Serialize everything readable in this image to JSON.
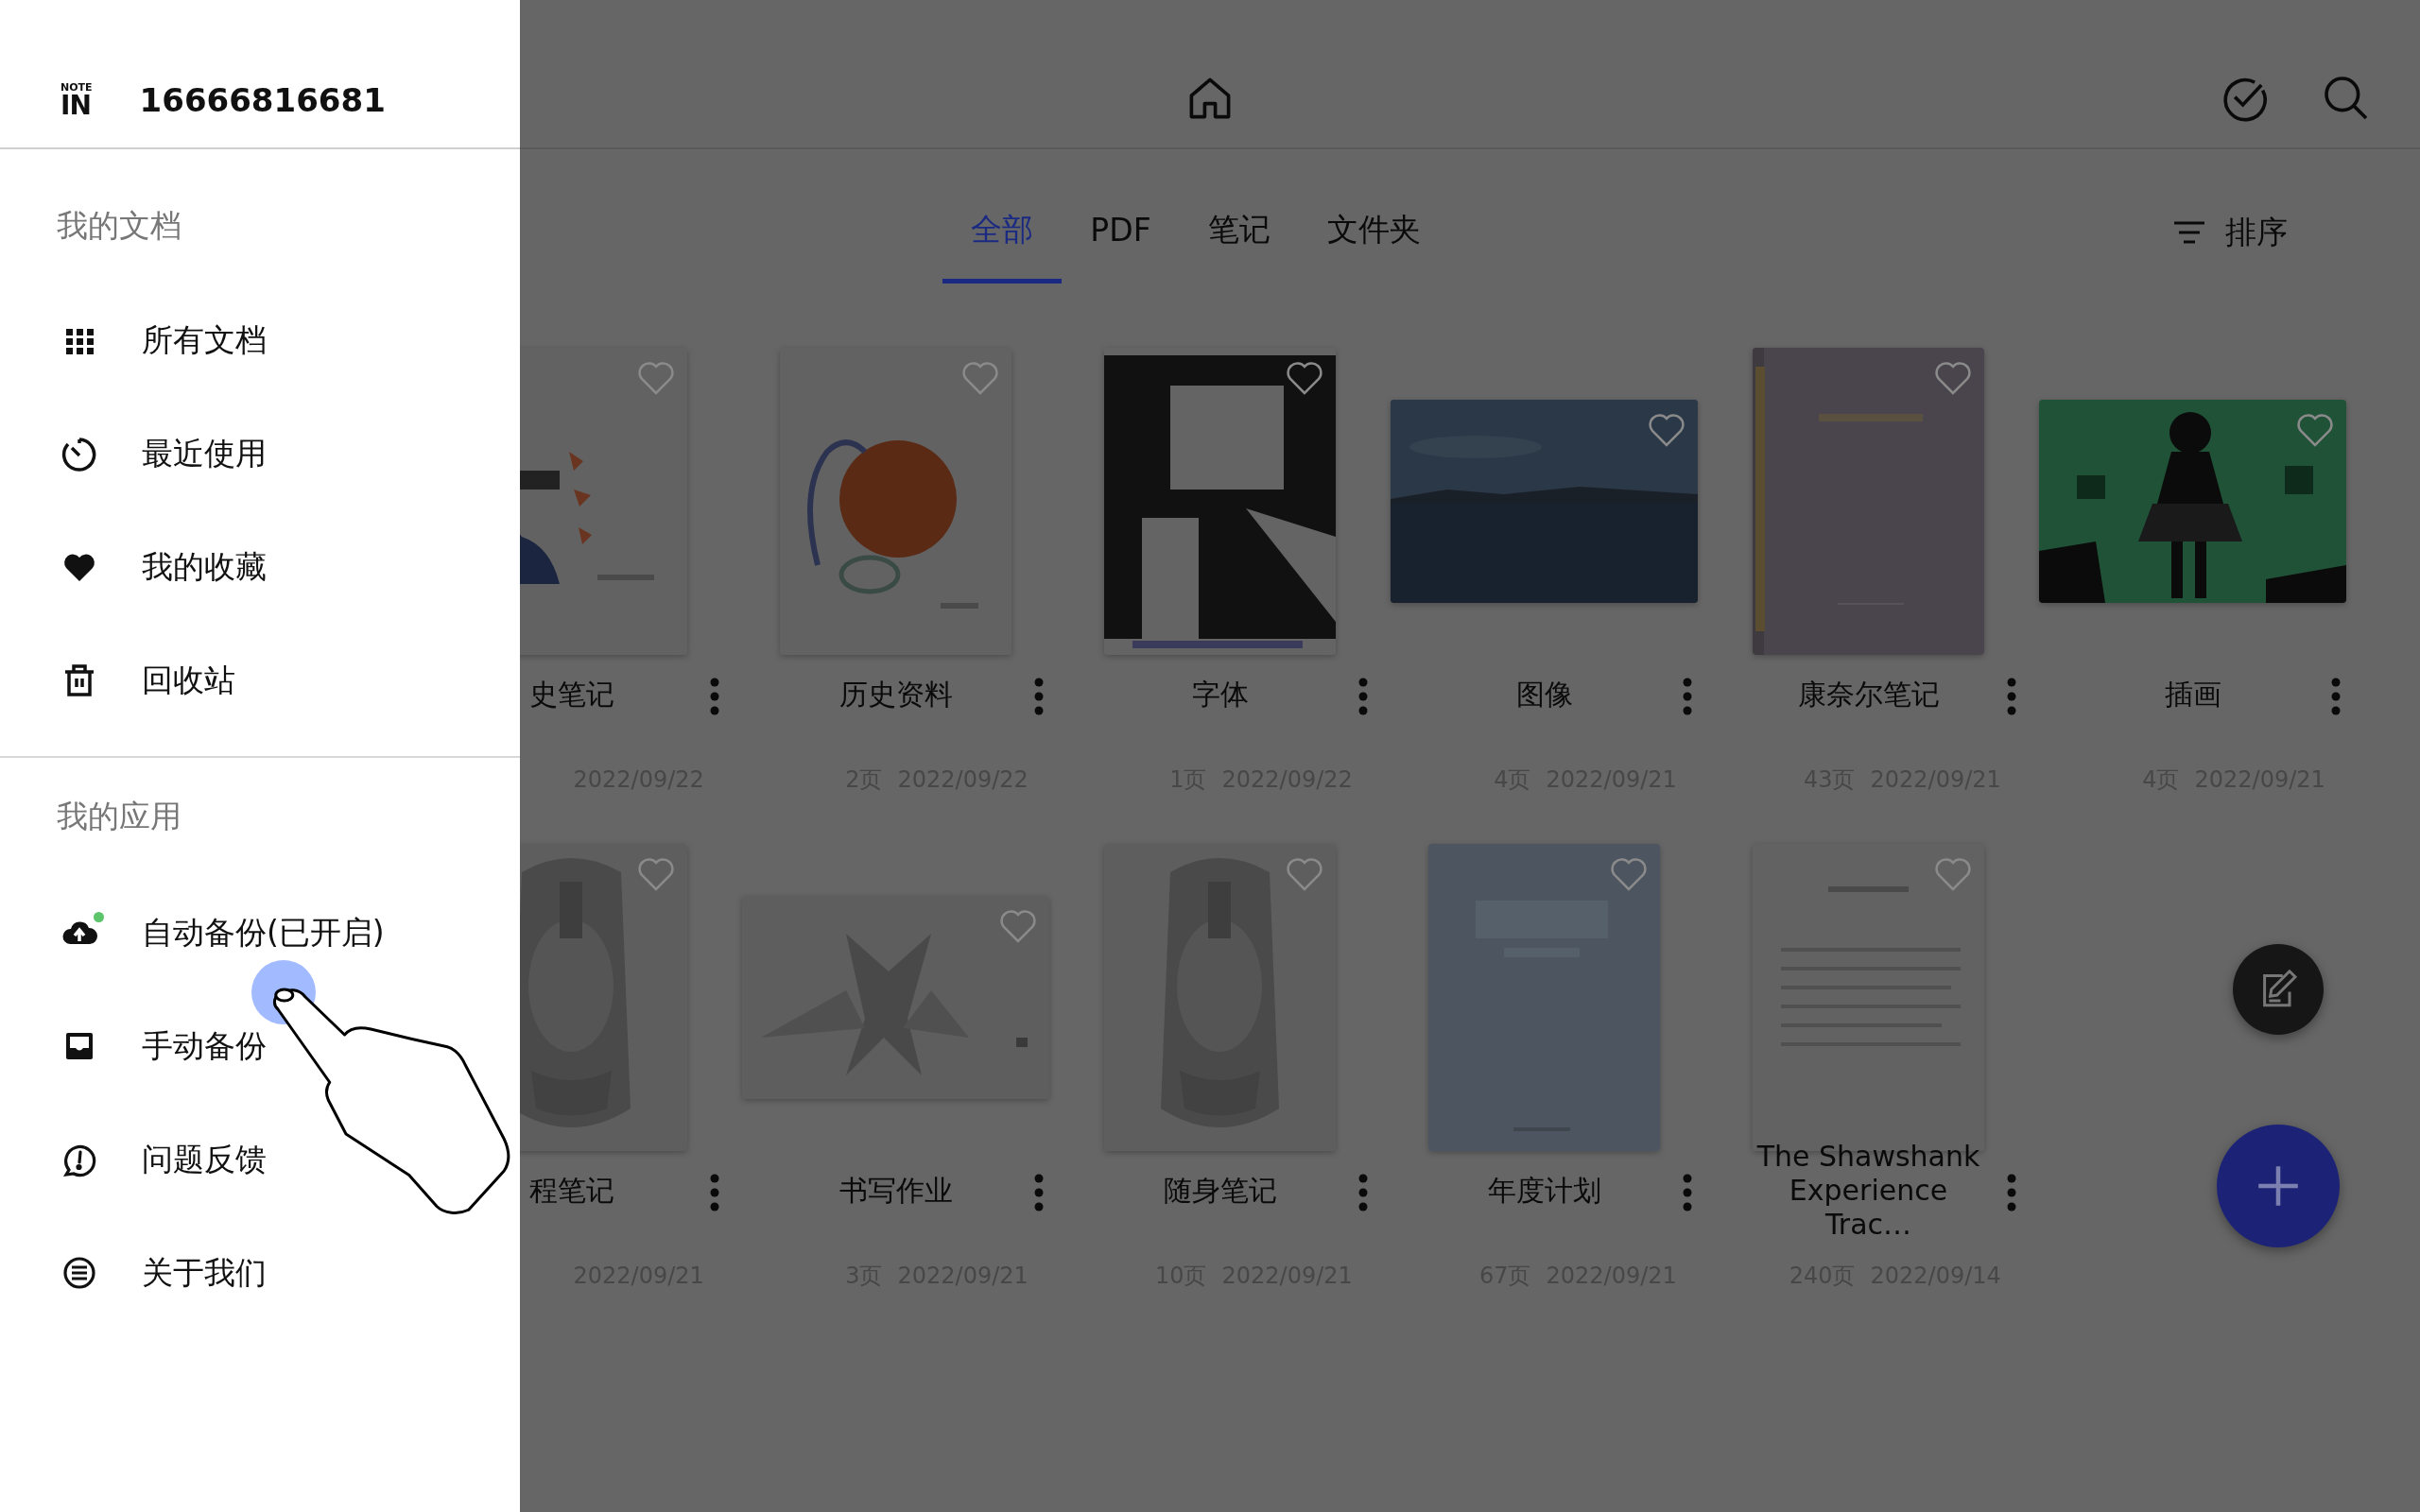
{
  "drawer": {
    "logo": {
      "small": "NOTE",
      "large": "IN"
    },
    "account": "16666816681",
    "sections": [
      {
        "heading": "我的文档",
        "items": [
          {
            "label": "所有文档",
            "indicator": false
          },
          {
            "label": "最近使用",
            "indicator": false
          },
          {
            "label": "我的收藏",
            "indicator": false
          },
          {
            "label": "回收站",
            "indicator": false
          }
        ]
      },
      {
        "heading": "我的应用",
        "items": [
          {
            "label": "自动备份(已开启)",
            "indicator": true
          },
          {
            "label": "手动备份",
            "indicator": false
          },
          {
            "label": "问题反馈",
            "indicator": false
          },
          {
            "label": "关于我们",
            "indicator": false
          }
        ]
      }
    ]
  },
  "tabs": [
    {
      "label": "全部",
      "selected": true
    },
    {
      "label": "PDF",
      "selected": false
    },
    {
      "label": "笔记",
      "selected": false
    },
    {
      "label": "文件夹",
      "selected": false
    }
  ],
  "sort": {
    "label": "排序"
  },
  "documents": [
    {
      "title": "史笔记",
      "date": "2022/09/22",
      "favorite": false
    },
    {
      "title": "历史资料",
      "pages": "2页",
      "date": "2022/09/22",
      "favorite": false
    },
    {
      "title": "字体",
      "pages": "1页",
      "date": "2022/09/22",
      "favorite": false
    },
    {
      "title": "图像",
      "pages": "4页",
      "date": "2022/09/21",
      "favorite": false
    },
    {
      "title": "康奈尔笔记",
      "pages": "43页",
      "date": "2022/09/21",
      "favorite": false
    },
    {
      "title": "插画",
      "pages": "4页",
      "date": "2022/09/21",
      "favorite": false
    },
    {
      "title": "程笔记",
      "date": "2022/09/21",
      "favorite": false
    },
    {
      "title": "书写作业",
      "pages": "3页",
      "date": "2022/09/21",
      "favorite": false
    },
    {
      "title": "随身笔记",
      "pages": "10页",
      "date": "2022/09/21",
      "favorite": false
    },
    {
      "title": "年度计划",
      "pages": "67页",
      "date": "2022/09/21",
      "favorite": false
    },
    {
      "title": "The Shawshank Experience Trac…",
      "pages": "240页",
      "date": "2022/09/14",
      "favorite": false
    }
  ]
}
